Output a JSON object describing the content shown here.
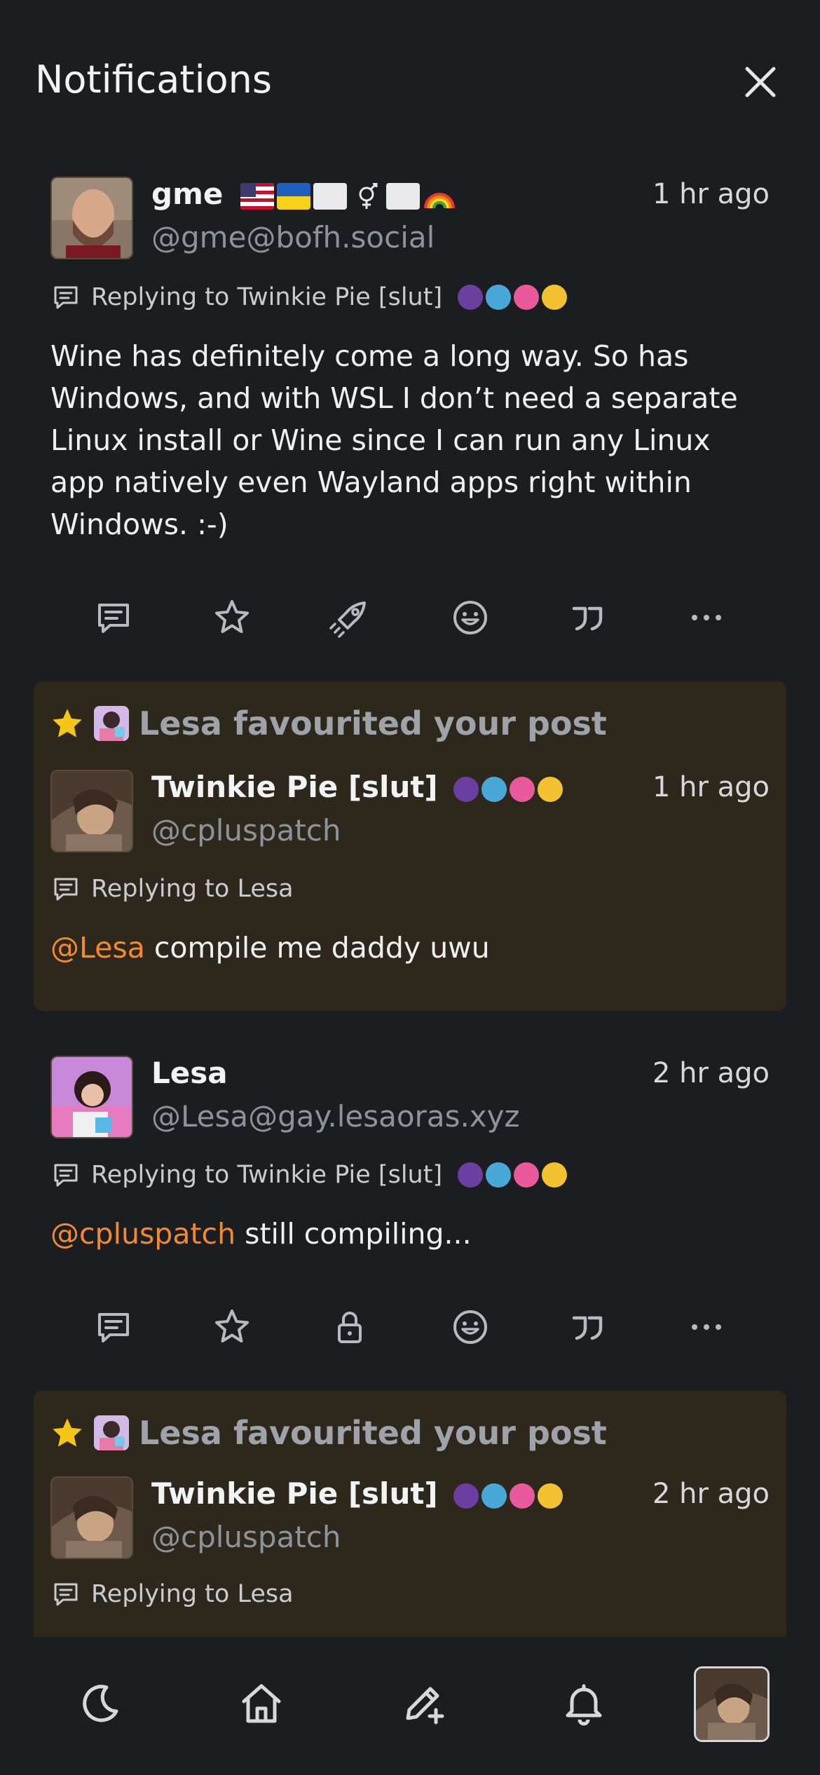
{
  "header": {
    "title": "Notifications",
    "close_icon": "close-icon"
  },
  "posts": [
    {
      "name": "gme",
      "name_emojis": [
        "flag-us",
        "flag-ukraine",
        "flag-white",
        "transgender-symbol",
        "flag-white",
        "rainbow"
      ],
      "handle": "@gme@bofh.social",
      "time": "1 hr ago",
      "reply_to": "Replying to Twinkie Pie [slut]",
      "body": "Wine has definitely come a long way. So has Windows, and with WSL I don’t need a separate Linux install or Wine since I can run any Linux app natively even Wayland apps right within Windows. :-)",
      "boost_icon": "rocket-icon"
    },
    {
      "fav_text": "Lesa favourited your post",
      "name": "Twinkie Pie [slut]",
      "handle": "@cpluspatch",
      "time": "1 hr ago",
      "reply_to": "Replying to Lesa",
      "mention": "@Lesa",
      "body": " compile me daddy uwu"
    },
    {
      "name": "Lesa",
      "handle": "@Lesa@gay.lesaoras.xyz",
      "time": "2 hr ago",
      "reply_to": "Replying to Twinkie Pie [slut]",
      "mention": "@cpluspatch",
      "body": " still compiling...",
      "boost_icon": "lock-icon"
    },
    {
      "fav_text": "Lesa favourited your post",
      "name": "Twinkie Pie [slut]",
      "handle": "@cpluspatch",
      "time": "2 hr ago",
      "reply_to": "Replying to Lesa"
    }
  ],
  "badge_colors": [
    "#6b3fa0",
    "#4aa8d8",
    "#e85a9b",
    "#f2c230"
  ],
  "action_icons": [
    "reply-icon",
    "star-icon",
    "boost-icon",
    "emoji-react-icon",
    "quote-icon",
    "more-icon"
  ],
  "nav": [
    "moon-icon",
    "home-icon",
    "compose-icon",
    "bell-icon",
    "profile-avatar"
  ],
  "colors": {
    "accent": "#f28a2e",
    "highlight_bg": "#2d271c",
    "star": "#f5c518",
    "bg": "#1c1d21"
  }
}
